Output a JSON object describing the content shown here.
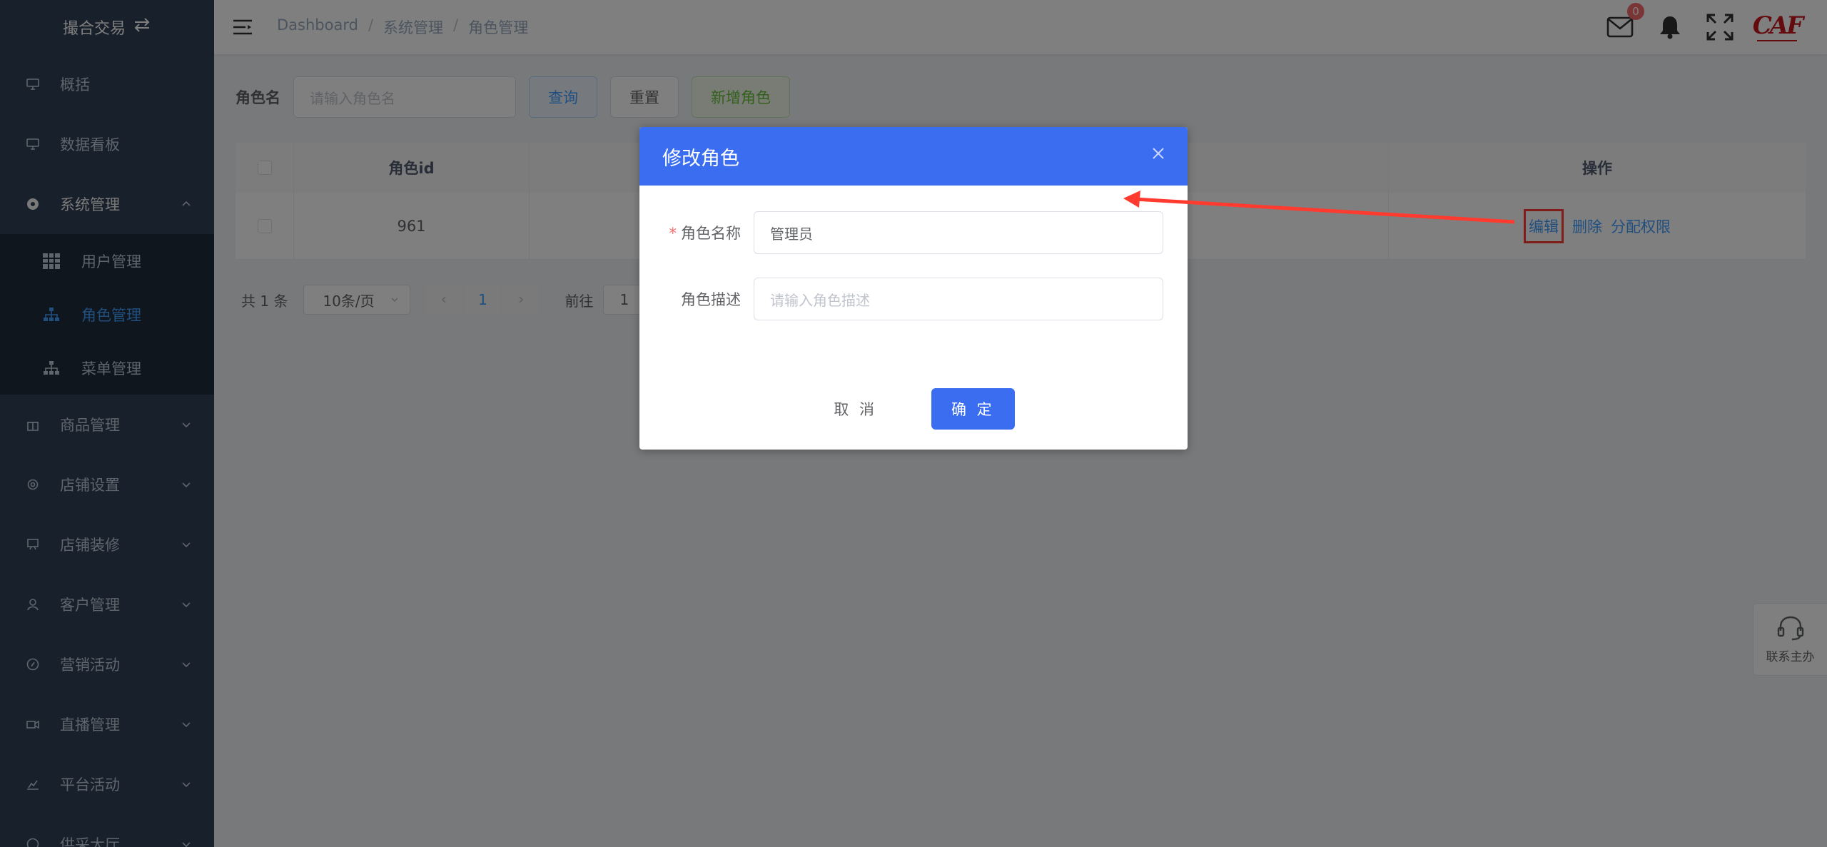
{
  "app": {
    "logo_text": "撮合交易"
  },
  "sidebar": {
    "items": [
      {
        "label": "概括",
        "icon": "monitor-icon"
      },
      {
        "label": "数据看板",
        "icon": "monitor-icon"
      },
      {
        "label": "系统管理",
        "icon": "settings-circle-icon",
        "expanded": true
      },
      {
        "label": "商品管理",
        "icon": "gift-icon"
      },
      {
        "label": "店铺设置",
        "icon": "gear-icon"
      },
      {
        "label": "店铺装修",
        "icon": "easel-icon"
      },
      {
        "label": "客户管理",
        "icon": "user-icon"
      },
      {
        "label": "营销活动",
        "icon": "compass-icon"
      },
      {
        "label": "直播管理",
        "icon": "camera-icon"
      },
      {
        "label": "平台活动",
        "icon": "chart-icon"
      },
      {
        "label": "供采大厅",
        "icon": "hall-icon"
      }
    ],
    "submenu": [
      {
        "label": "用户管理",
        "icon": "grid-icon",
        "active": false
      },
      {
        "label": "角色管理",
        "icon": "org-icon",
        "active": true
      },
      {
        "label": "菜单管理",
        "icon": "org-icon",
        "active": false
      }
    ]
  },
  "header": {
    "breadcrumb": [
      "Dashboard",
      "系统管理",
      "角色管理"
    ],
    "mail_badge": "0"
  },
  "filter": {
    "label": "角色名",
    "placeholder": "请输入角色名",
    "query_label": "查询",
    "reset_label": "重置",
    "add_label": "新增角色"
  },
  "table": {
    "columns": [
      "角色id",
      "操作"
    ],
    "rows": [
      {
        "id": "961",
        "actions": [
          "编辑",
          "删除",
          "分配权限"
        ]
      }
    ]
  },
  "pager": {
    "total": "共 1 条",
    "page_size": "10条/页",
    "current_page": "1",
    "goto_label": "前往",
    "goto_value": "1"
  },
  "float_contact": {
    "label": "联系主办"
  },
  "dialog": {
    "title": "修改角色",
    "name_label": "角色名称",
    "name_value": "管理员",
    "desc_label": "角色描述",
    "desc_placeholder": "请输入角色描述",
    "cancel_label": "取 消",
    "ok_label": "确 定"
  },
  "colors": {
    "sidebar_bg": "#304156",
    "accent": "#409eff",
    "dialog_header": "#3a6df0",
    "annotation": "#ff3b30"
  }
}
